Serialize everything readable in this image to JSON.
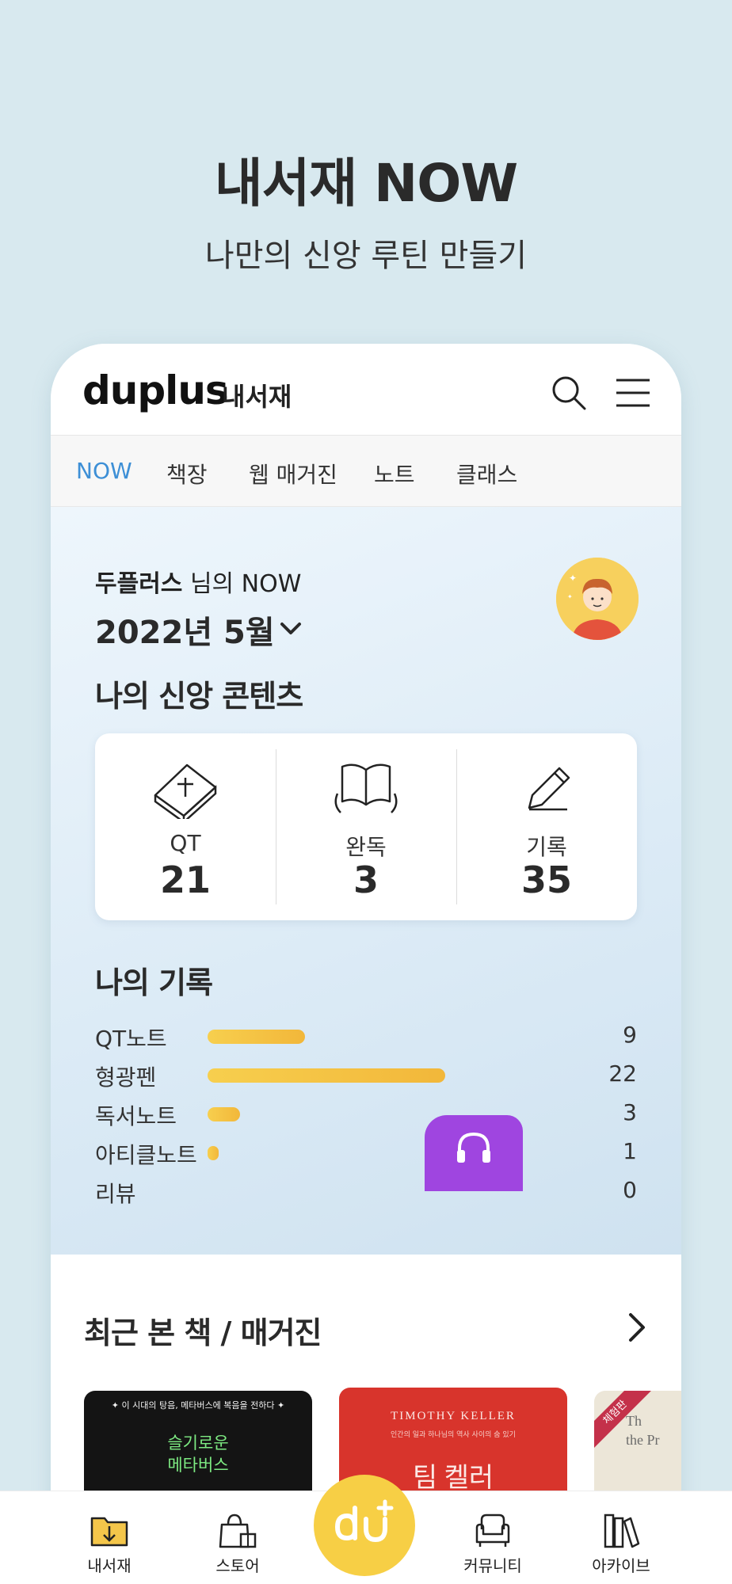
{
  "hero": {
    "title": "내서재 NOW",
    "subtitle": "나만의 신앙 루틴 만들기"
  },
  "header": {
    "logo": "duplus",
    "section": "내서재",
    "search_icon": "search-icon",
    "menu_icon": "hamburger-menu-icon"
  },
  "tabs": [
    {
      "label": "NOW",
      "active": true
    },
    {
      "label": "책장",
      "active": false
    },
    {
      "label": "웹 매거진",
      "active": false
    },
    {
      "label": "노트",
      "active": false
    },
    {
      "label": "클래스",
      "active": false
    }
  ],
  "now": {
    "user_name": "두플러스",
    "greeting_suffix": " 님의 NOW",
    "month": "2022년 5월",
    "contents_title": "나의 신앙 콘텐츠",
    "stats": [
      {
        "label": "QT",
        "value": "21",
        "icon": "bible-icon"
      },
      {
        "label": "완독",
        "value": "3",
        "icon": "open-book-icon"
      },
      {
        "label": "기록",
        "value": "35",
        "icon": "pencil-icon"
      }
    ],
    "records_title": "나의 기록",
    "records_max": 22,
    "records": [
      {
        "label": "QT노트",
        "value": 9
      },
      {
        "label": "형광펜",
        "value": 22
      },
      {
        "label": "독서노트",
        "value": 3
      },
      {
        "label": "아티클노트",
        "value": 1
      },
      {
        "label": "리뷰",
        "value": 0
      }
    ]
  },
  "recent": {
    "title": "최근 본 책 / 매거진",
    "books": [
      {
        "top_text": "✦ 이 시대의 탕음, 메타버스에 복음을 전하다 ✦",
        "title_line1": "슬기로운",
        "title_line2": "메타버스"
      },
      {
        "author": "TIMOTHY KELLER",
        "subtitle": "인간의 일과 하나님의 역사 사이의 숨 있기",
        "title": "팀 켈러"
      },
      {
        "badge": "체험판",
        "title_line1": "Th",
        "title_line2": "the Pr"
      }
    ]
  },
  "audio_fab_icon": "headphones-icon",
  "bottom_nav": [
    {
      "label": "내서재",
      "icon": "library-download-icon"
    },
    {
      "label": "스토어",
      "icon": "shopping-bag-icon"
    },
    {
      "label": "커뮤니티",
      "icon": "sofa-icon"
    },
    {
      "label": "아카이브",
      "icon": "books-archive-icon"
    }
  ],
  "center_button_icon": "duplus-plus-icon",
  "colors": {
    "background": "#d8e9ef",
    "accent_blue": "#3d8fd6",
    "bar_yellow": "#f2b73a",
    "center_yellow": "#f7cf45",
    "audio_purple": "#9f45e0"
  }
}
